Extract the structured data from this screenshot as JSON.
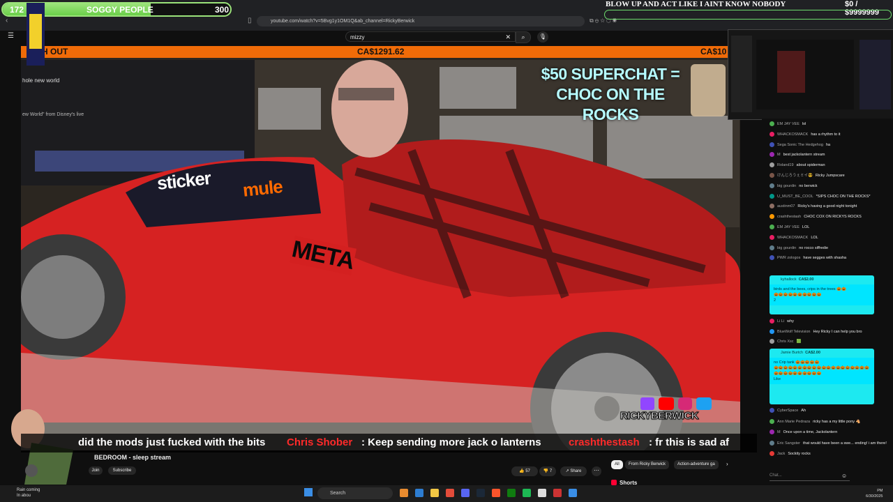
{
  "browser": {
    "url": "youtube.com/watch?v=5Bvg1y1OM1Q&ab_channel=RickyBerwick",
    "back_icon": "back-arrow-icon"
  },
  "overlay": {
    "counter_left": "172",
    "counter_title": "SOGGY PEOPLE",
    "counter_right": "300",
    "counter_fill_fraction": 0.65,
    "goal_title": "BLOW UP AND ACT LIKE I AINT KNOW NOBODY",
    "goal_amount": "$0  /  $9999999",
    "orange_left": "H OUT",
    "orange_amount": "CA$1291.62",
    "orange_right": "CA$10",
    "superchat_line1": "$50 SUPERCHAT =",
    "superchat_line2": "CHOC ON THE ROCKS",
    "left_text_1": "hole new world",
    "left_text_2": "ew World\" from Disney's live",
    "sticker_a": "sticker",
    "sticker_b": "mule",
    "meta": "META",
    "rb_name": "RICKYBERWICK"
  },
  "youtube": {
    "search_query": "mizzy",
    "title": "BEDROOM - sleep stream",
    "join": "Join",
    "subscribe": "Subscribe",
    "likes": "57",
    "dislikes": "7",
    "share": "Share",
    "chips": [
      "All",
      "From Ricky Berwick",
      "Action-adventure ga"
    ],
    "shorts": "Shorts"
  },
  "ticker": [
    {
      "text": "did the mods just fucked with the bits",
      "color": "#ffffff"
    },
    {
      "text": "Chris Shober",
      "color": "#ff2a2a"
    },
    {
      "text": ": Keep sending more jack o lanterns",
      "color": "#ffffff"
    },
    {
      "text": "crashthestash",
      "color": "#ff2a2a"
    },
    {
      "text": ": fr this is sad af",
      "color": "#ffffff"
    }
  ],
  "chat": {
    "messages": [
      {
        "author": "EM JAY VEE",
        "text": "lol",
        "color": "#4caf50"
      },
      {
        "author": "WHACKOSMACK",
        "text": "has a rhythm to it",
        "color": "#e91e63"
      },
      {
        "author": "Sega Sonic The Hedgehog",
        "text": "ha",
        "color": "#3f51b5"
      },
      {
        "author": "M",
        "text": "best jackolantern stream",
        "color": "#9c27b0"
      },
      {
        "author": "Roland19",
        "text": "about spiderman",
        "color": "#9e9e9e"
      },
      {
        "author": "けんじろうぇミイ😎",
        "text": "Ricky Jumpscare",
        "color": "#795548"
      },
      {
        "author": "big gourdin",
        "text": "no berwick",
        "color": "#607d8b"
      },
      {
        "author": "U_MUST_BE_COOL",
        "text": "*SIPS CHOC ON THE ROCKS*",
        "color": "#009688"
      },
      {
        "author": "austinm07",
        "text": "Ricky's having a good night tonight",
        "color": "#8d6e63"
      },
      {
        "author": "crashthestash",
        "text": "CHOC COX ON RICKYS ROCKS",
        "color": "#ff9800"
      },
      {
        "author": "EM JAY VEE",
        "text": "LOL",
        "color": "#4caf50"
      },
      {
        "author": "WHACKOSMACK",
        "text": "LOL",
        "color": "#e91e63"
      },
      {
        "author": "big gourdin",
        "text": "no rocco siffredie",
        "color": "#607d8b"
      },
      {
        "author": "PWR zologos",
        "text": "have segges with shasha",
        "color": "#3f51b5"
      }
    ],
    "superchat1": {
      "author": "kyhallock",
      "amount": "CA$2.00",
      "text": "birds and the bees, crips in the trees 🎃🎃",
      "extra": "🎃🎃🎃🎃🎃🎃🎃🎃🎃🎃",
      "likes": "2"
    },
    "messages2": [
      {
        "author": "Li Li",
        "text": "why",
        "color": "#e91e63"
      },
      {
        "author": "BlueWolf Television",
        "text": "Hey Ricky I can help you bro",
        "color": "#2196f3"
      },
      {
        "author": "Chris Xsc",
        "text": "🟩",
        "color": "#9e9e9e"
      }
    ],
    "superchat2": {
      "author": "Jamie Burtch",
      "amount": "CA$2.00",
      "text": "no Crip tank 🎃🎃🎃🎃🎃",
      "extra": "🎃🎃🎃🎃🎃🎃🎃🎃🎃🎃🎃🎃🎃🎃🎃🎃🎃🎃🎃🎃🎃🎃🎃🎃🎃🎃🎃🎃🎃🎃",
      "likes": "Like"
    },
    "messages3": [
      {
        "author": "CyberSpace",
        "text": "Ah",
        "color": "#3f51b5"
      },
      {
        "author": "Ann Marie Pedraza",
        "text": "ricky has a my little pony 🐴",
        "color": "#4caf50"
      },
      {
        "author": "M",
        "text": "Once upon a time, Jackolantern",
        "color": "#9c27b0"
      },
      {
        "author": "Eric Sangster",
        "text": "that would have been a swe... ending! i am there!",
        "color": "#607d8b"
      },
      {
        "author": "Jack",
        "text": "Sockity rocks",
        "color": "#e53935"
      }
    ],
    "input_placeholder": "Chat..."
  },
  "taskbar": {
    "weather_line1": "Rain coming",
    "weather_line2": "In abou",
    "search": "Search",
    "time": "PM",
    "date": "6/30/2025"
  }
}
